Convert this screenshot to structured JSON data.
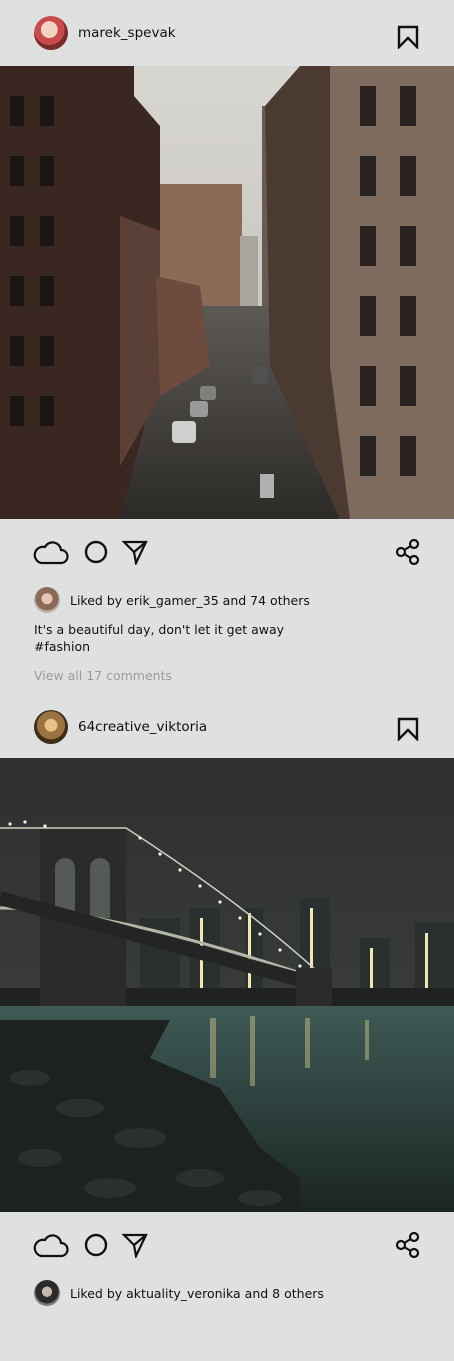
{
  "posts": [
    {
      "username": "marek_spevak",
      "likes_prefix": "Liked by ",
      "liked_by": "erik_gamer_35",
      "likes_suffix": " and 74 others",
      "caption_line1": "It's a beautiful day, don't let it get away",
      "caption_line2": "#fashion",
      "comments_link": "View all 17 comments"
    },
    {
      "username": "64creative_viktoria",
      "likes_prefix": "Liked by ",
      "liked_by": "aktuality_veronika",
      "likes_suffix": " and 8 others"
    }
  ],
  "icons": {
    "bookmark": "bookmark-icon",
    "like": "cloud-icon",
    "comment": "circle-icon",
    "send": "send-arrow-icon",
    "share": "share-icon"
  },
  "colors": {
    "background": "#dfe1e0",
    "text": "#111111",
    "muted": "#9a9c9b"
  }
}
